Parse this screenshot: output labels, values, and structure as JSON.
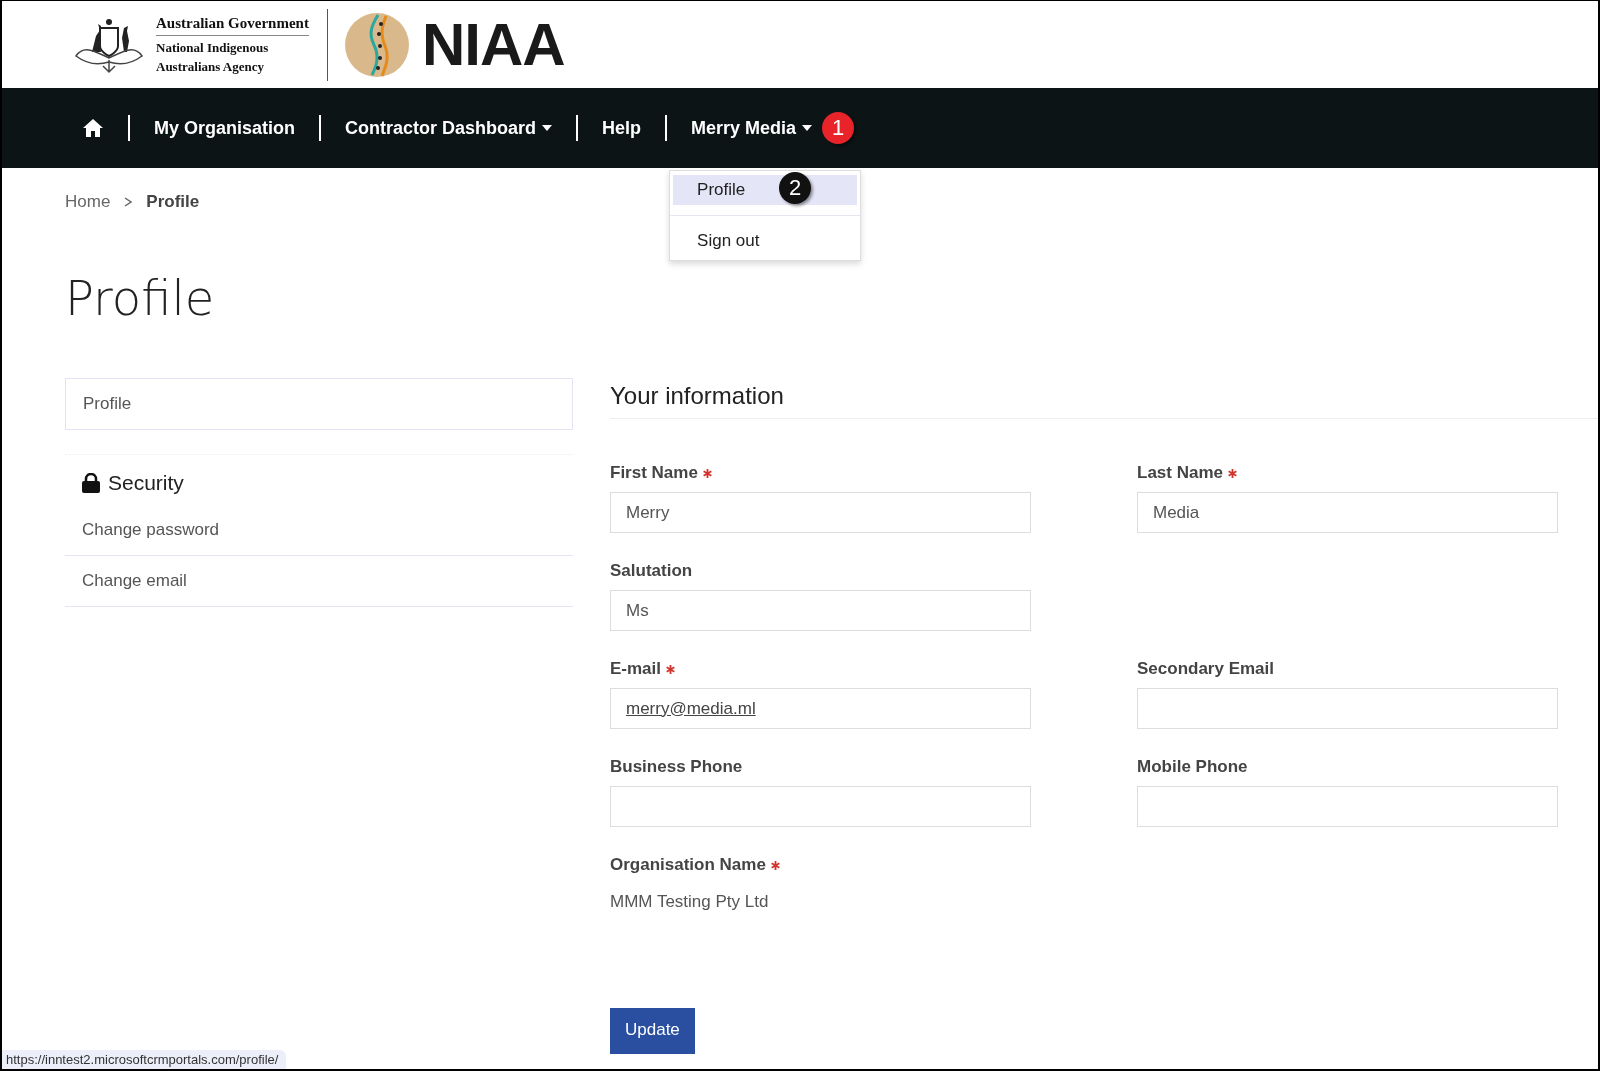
{
  "header": {
    "government": "Australian Government",
    "agency_line_1": "National Indigenous",
    "agency_line_2": "Australians Agency",
    "brand": "NIAA"
  },
  "nav": {
    "items": [
      {
        "kind": "home"
      },
      {
        "kind": "link",
        "label": "My Organisation"
      },
      {
        "kind": "dropdown",
        "label": "Contractor Dashboard"
      },
      {
        "kind": "link",
        "label": "Help"
      },
      {
        "kind": "dropdown",
        "label": "Merry Media",
        "expanded": true,
        "callout": "1"
      }
    ]
  },
  "user_menu": [
    {
      "label": "Profile",
      "selected": true,
      "callout": "2"
    },
    {
      "label": "Sign out",
      "selected": false
    }
  ],
  "breadcrumb": [
    {
      "label": "Home",
      "current": false
    },
    {
      "label": "Profile",
      "current": true
    }
  ],
  "page_title": "Profile",
  "sidebar": {
    "items": [
      {
        "label": "Profile"
      }
    ],
    "security": {
      "title": "Security",
      "items": [
        "Change password",
        "Change email"
      ]
    }
  },
  "form": {
    "heading": "Your information",
    "rows": [
      [
        {
          "kind": "text-input",
          "label": "First Name",
          "required": true,
          "value": "Merry"
        },
        {
          "kind": "text-input",
          "label": "Last Name",
          "required": true,
          "value": "Media"
        }
      ],
      [
        {
          "kind": "text-input",
          "label": "Salutation",
          "value": "Ms"
        }
      ],
      [
        {
          "kind": "link-input",
          "label": "E-mail",
          "required": true,
          "value": "merry@media.ml"
        },
        {
          "kind": "text-input",
          "label": "Secondary Email"
        }
      ],
      [
        {
          "kind": "text-input",
          "label": "Business Phone"
        },
        {
          "kind": "text-input",
          "label": "Mobile Phone"
        }
      ],
      [
        {
          "kind": "readonly",
          "label": "Organisation Name",
          "required": true,
          "value": "MMM Testing Pty Ltd"
        }
      ]
    ],
    "submit": "Update"
  },
  "status_bar": "https://inntest2.microsoftcrmportals.com/profile/"
}
